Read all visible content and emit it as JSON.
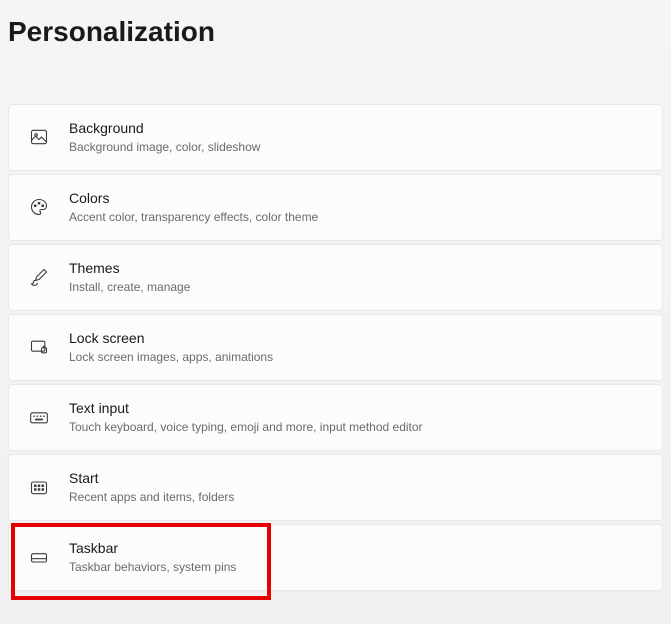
{
  "page": {
    "title": "Personalization"
  },
  "items": [
    {
      "title": "Background",
      "subtitle": "Background image, color, slideshow"
    },
    {
      "title": "Colors",
      "subtitle": "Accent color, transparency effects, color theme"
    },
    {
      "title": "Themes",
      "subtitle": "Install, create, manage"
    },
    {
      "title": "Lock screen",
      "subtitle": "Lock screen images, apps, animations"
    },
    {
      "title": "Text input",
      "subtitle": "Touch keyboard, voice typing, emoji and more, input method editor"
    },
    {
      "title": "Start",
      "subtitle": "Recent apps and items, folders"
    },
    {
      "title": "Taskbar",
      "subtitle": "Taskbar behaviors, system pins"
    }
  ]
}
